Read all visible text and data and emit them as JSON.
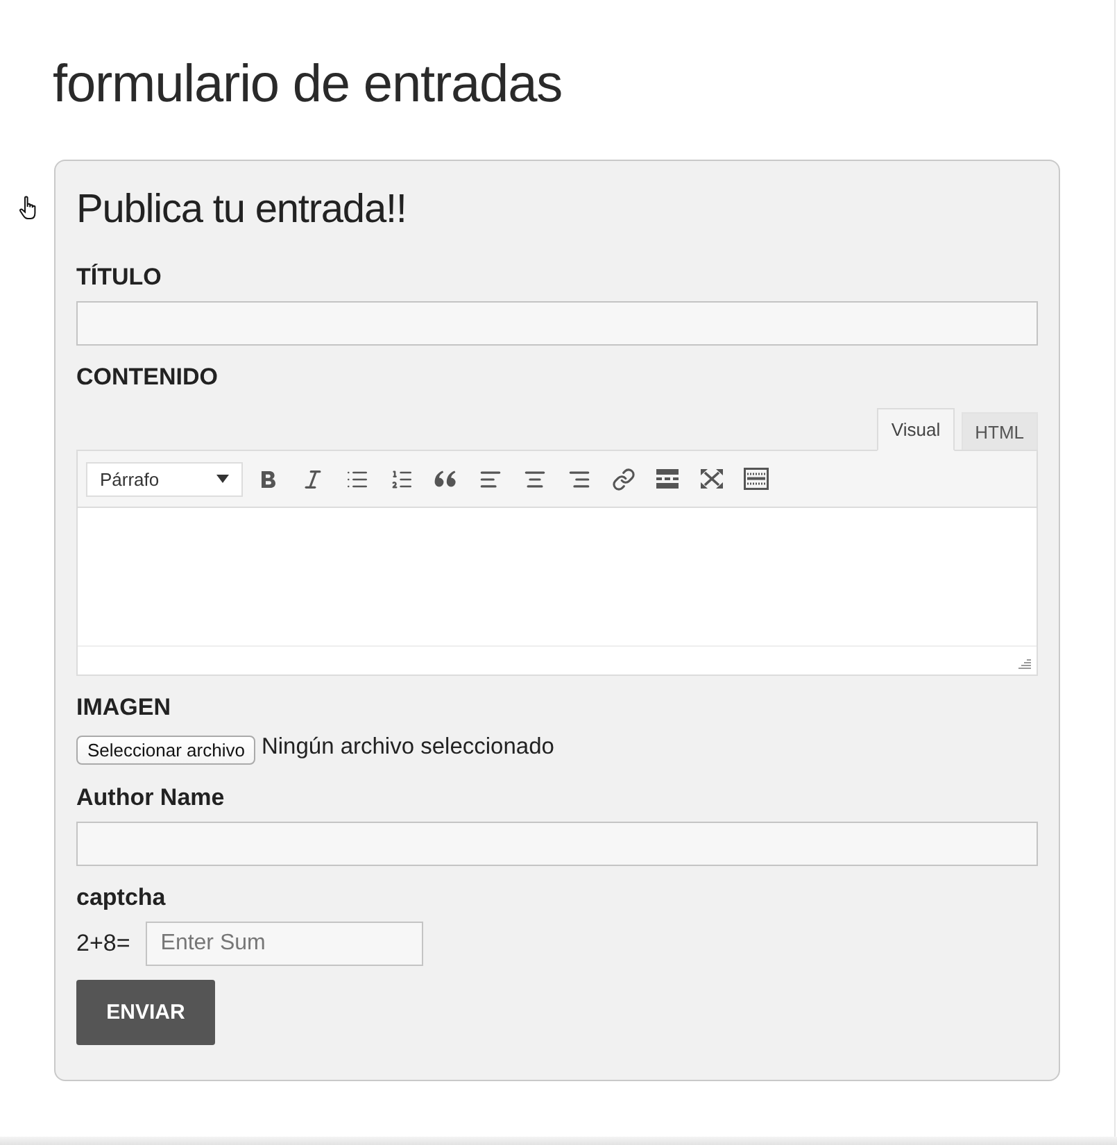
{
  "page": {
    "title": "formulario de entradas"
  },
  "form": {
    "heading": "Publica tu entrada!!",
    "fields": [
      {
        "kind": "text",
        "label": "TÍTULO"
      },
      {
        "kind": "editor",
        "label": "CONTENIDO",
        "tabs": [
          {
            "label": "Visual",
            "selected": true
          },
          {
            "label": "HTML",
            "selected": false
          }
        ],
        "format": "Párrafo"
      },
      {
        "kind": "file",
        "label": "IMAGEN",
        "button": "Seleccionar archivo",
        "status": "Ningún archivo seleccionado"
      },
      {
        "kind": "text",
        "label": "Author Name"
      },
      {
        "kind": "captcha",
        "label": "captcha",
        "question": "2+8=",
        "placeholder": "Enter Sum"
      }
    ],
    "submit": {
      "label": "ENVIAR"
    }
  }
}
